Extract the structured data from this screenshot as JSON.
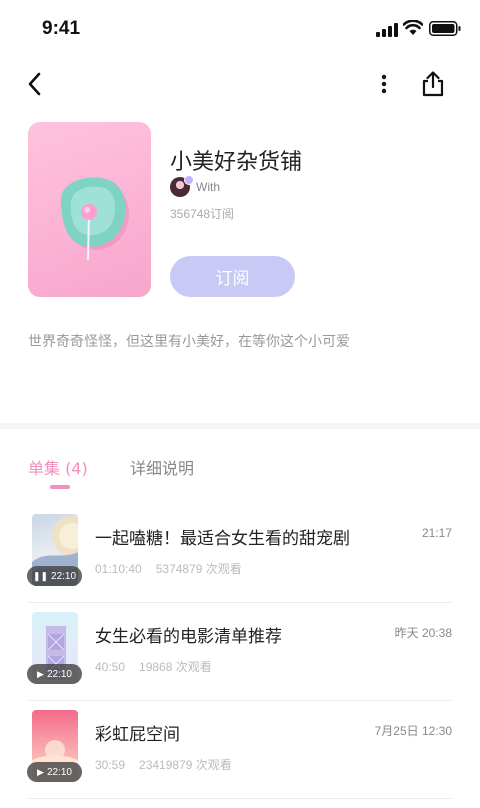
{
  "status_bar": {
    "time": "9:41"
  },
  "channel": {
    "title": "小美好杂货铺",
    "author": "With",
    "subscribers": "356748订阅",
    "subscribe_label": "订阅",
    "description": "世界奇奇怪怪，但这里有小美好，在等你这个小可爱"
  },
  "tabs": {
    "episodes": "单集 (4)",
    "details": "详细说明"
  },
  "episodes": [
    {
      "title": "一起嗑糖！最适合女生看的甜宠剧",
      "date": "21:17",
      "length": "01:10:40",
      "views": "5374879 次观看",
      "badge": "22:10",
      "state_icon": "pause-icon"
    },
    {
      "title": "女生必看的电影清单推荐",
      "date": "昨天 20:38",
      "length": "40:50",
      "views": "19868 次观看",
      "badge": "22:10",
      "state_icon": "play-icon"
    },
    {
      "title": "彩虹屁空间",
      "date": "7月25日 12:30",
      "length": "30:59",
      "views": "23419879 次观看",
      "badge": "22:10",
      "state_icon": "play-icon"
    }
  ],
  "colors": {
    "accent": "#f58dbd",
    "subscribe_bg": "#c9c9f6",
    "cover_bg": "#ffc3dd"
  },
  "icons": [
    "signal-icon",
    "wifi-icon",
    "battery-icon",
    "back-icon",
    "more-icon",
    "share-icon"
  ]
}
